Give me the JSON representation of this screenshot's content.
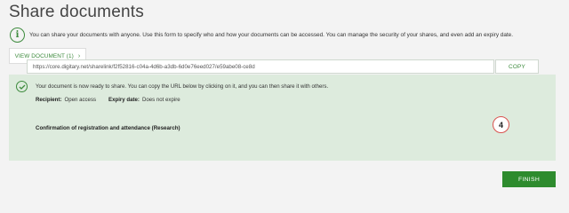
{
  "header": {
    "title": "Share documents"
  },
  "info": {
    "icon": "info-icon",
    "text": "You can share your documents with anyone. Use this form to specify who and how your documents can be accessed. You can manage the security of your shares, and even add an expiry date."
  },
  "view_button": {
    "label": "VIEW DOCUMENT (1)",
    "icon": "chevron-right-icon"
  },
  "panel": {
    "icon": "check-circle-icon",
    "ready_text": "Your document is now ready to share. You can copy the URL below by clicking on it, and you can then share it with others.",
    "recipient_label": "Recipient:",
    "recipient_value": "Open access",
    "expiry_label": "Expiry date:",
    "expiry_value": "Does not expire",
    "document_title": "Confirmation of registration and attendance (Research)",
    "share_url": "https://core.digitary.net/sharelink/f2f52816-c04a-4d6b-a3db-6d0e76eed027/e59abe08-ce8d",
    "copy_label": "COPY"
  },
  "step_badge": "4",
  "finish_label": "FINISH",
  "colors": {
    "accent": "#2e8b2e",
    "panel_bg": "#ddebdd",
    "badge_border": "#d9534f"
  }
}
